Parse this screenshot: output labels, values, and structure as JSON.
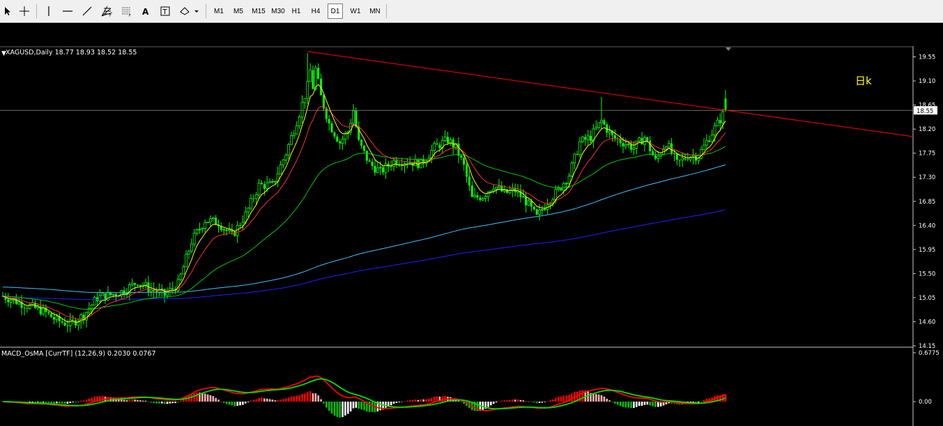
{
  "toolbar": {
    "timeframes": [
      "M1",
      "M5",
      "M15",
      "M30",
      "H1",
      "H4",
      "D1",
      "W1",
      "MN"
    ],
    "active_timeframe": "D1",
    "icons": [
      "cursor-icon",
      "crosshair-icon",
      "vertical-line-icon",
      "horizontal-line-icon",
      "trendline-icon",
      "fibonacci-fan-icon",
      "fibonacci-grid-icon",
      "text-icon",
      "text-label-icon",
      "shapes-icon"
    ]
  },
  "chart_header": {
    "symbol_line": "XAGUSD,Daily  18.77 18.93 18.52 18.55"
  },
  "annotation": "日k",
  "price_axis": {
    "ticks": [
      "19.55",
      "19.10",
      "18.65",
      "18.20",
      "17.75",
      "17.30",
      "16.85",
      "16.40",
      "15.95",
      "15.50",
      "15.05",
      "14.60",
      "14.15"
    ],
    "current_price": "18.55"
  },
  "indicator": {
    "label": "MACD_OsMA [CurrTF] (12,26,9) 0.2030 0.0767",
    "ticks": [
      "0.6775",
      "0.00"
    ]
  },
  "colors": {
    "bull_candle": "#00ff00",
    "bear_candle": "#00ff00",
    "trendline": "#ff0000",
    "ma_fast": "#ffff00",
    "ma_mid": "#ff3030",
    "ma_long": "#00c800",
    "ma_200": "#40c0ff",
    "ma_300": "#2020ff",
    "macd_signal": "#00e000",
    "macd_main": "#ff0000",
    "annotation": "#ffff00"
  },
  "chart_data": {
    "type": "candlestick",
    "symbol": "XAGUSD",
    "timeframe": "Daily",
    "last": {
      "open": 18.77,
      "high": 18.93,
      "low": 18.52,
      "close": 18.55
    },
    "ylim": [
      14.15,
      19.7
    ],
    "indicator_ylim": [
      -0.45,
      0.6775
    ]
  }
}
